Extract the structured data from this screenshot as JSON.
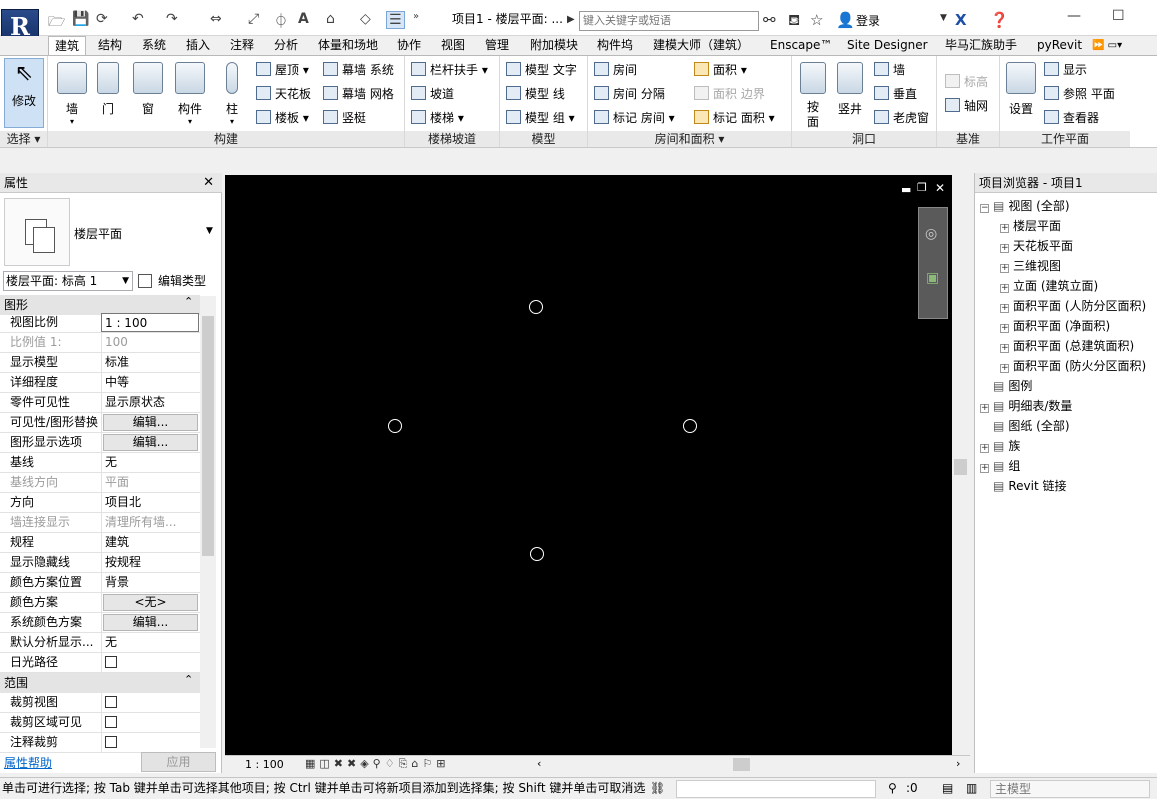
{
  "titlebar": {
    "title": "项目1 - 楼层平面: ...",
    "search_placeholder": "键入关键字或短语",
    "login": "登录"
  },
  "tabs": [
    "建筑",
    "结构",
    "系统",
    "插入",
    "注释",
    "分析",
    "体量和场地",
    "协作",
    "视图",
    "管理",
    "附加模块",
    "构件坞",
    "建模大师（建筑）",
    "Enscape™",
    "Site Designer",
    "毕马汇族助手",
    "pyRevit"
  ],
  "ribbon": {
    "modify": "修改",
    "select": "选择",
    "build": {
      "label": "构建",
      "wall": "墙",
      "door": "门",
      "window": "窗",
      "component": "构件",
      "column": "柱",
      "roof": "屋顶",
      "ceiling": "天花板",
      "floor": "楼板",
      "curtain_system": "幕墙 系统",
      "curtain_grid": "幕墙 网格",
      "mullion": "竖梃"
    },
    "stairs": {
      "label": "楼梯坡道",
      "railing": "栏杆扶手",
      "ramp": "坡道",
      "stair": "楼梯"
    },
    "model": {
      "label": "模型",
      "text": "模型 文字",
      "line": "模型 线",
      "group": "模型 组"
    },
    "room": {
      "label": "房间和面积",
      "room": "房间",
      "separator": "房间 分隔",
      "tag": "标记 房间",
      "area": "面积",
      "area_boundary": "面积 边界",
      "area_tag": "标记 面积"
    },
    "opening": {
      "label": "洞口",
      "by_face": "按面",
      "shaft": "竖井",
      "wall": "墙",
      "vertical": "垂直",
      "dormer": "老虎窗"
    },
    "datum": {
      "label": "基准",
      "level": "标高",
      "grid": "轴网"
    },
    "workplane": {
      "label": "工作平面",
      "set": "设置",
      "show": "显示",
      "ref_plane": "参照 平面",
      "viewer": "查看器"
    }
  },
  "properties": {
    "title": "属性",
    "type_name": "楼层平面",
    "selector": "楼层平面: 标高 1",
    "edit_type": "编辑类型",
    "section_graphics": "图形",
    "section_extents": "范围",
    "rows": [
      {
        "k": "视图比例",
        "v": "1 : 100"
      },
      {
        "k": "比例值 1:",
        "v": "100"
      },
      {
        "k": "显示模型",
        "v": "标准"
      },
      {
        "k": "详细程度",
        "v": "中等"
      },
      {
        "k": "零件可见性",
        "v": "显示原状态"
      },
      {
        "k": "可见性/图形替换",
        "v": "编辑..."
      },
      {
        "k": "图形显示选项",
        "v": "编辑..."
      },
      {
        "k": "基线",
        "v": "无"
      },
      {
        "k": "基线方向",
        "v": "平面"
      },
      {
        "k": "方向",
        "v": "项目北"
      },
      {
        "k": "墙连接显示",
        "v": "清理所有墙..."
      },
      {
        "k": "规程",
        "v": "建筑"
      },
      {
        "k": "显示隐藏线",
        "v": "按规程"
      },
      {
        "k": "颜色方案位置",
        "v": "背景"
      },
      {
        "k": "颜色方案",
        "v": "<无>"
      },
      {
        "k": "系统颜色方案",
        "v": "编辑..."
      },
      {
        "k": "默认分析显示...",
        "v": "无"
      },
      {
        "k": "日光路径",
        "v": ""
      }
    ],
    "extent_rows": [
      {
        "k": "裁剪视图",
        "v": ""
      },
      {
        "k": "裁剪区域可见",
        "v": ""
      },
      {
        "k": "注释裁剪",
        "v": ""
      }
    ],
    "help": "属性帮助",
    "apply": "应用"
  },
  "browser": {
    "title": "项目浏览器 - 项目1",
    "items": [
      {
        "label": "视图 (全部)",
        "level": 0,
        "exp": "⊟"
      },
      {
        "label": "楼层平面",
        "level": 1,
        "exp": "⊞"
      },
      {
        "label": "天花板平面",
        "level": 1,
        "exp": "⊞"
      },
      {
        "label": "三维视图",
        "level": 1,
        "exp": "⊞"
      },
      {
        "label": "立面 (建筑立面)",
        "level": 1,
        "exp": "⊞"
      },
      {
        "label": "面积平面 (人防分区面积)",
        "level": 1,
        "exp": "⊞"
      },
      {
        "label": "面积平面 (净面积)",
        "level": 1,
        "exp": "⊞"
      },
      {
        "label": "面积平面 (总建筑面积)",
        "level": 1,
        "exp": "⊞"
      },
      {
        "label": "面积平面 (防火分区面积)",
        "level": 1,
        "exp": "⊞"
      },
      {
        "label": "图例",
        "level": 0,
        "exp": ""
      },
      {
        "label": "明细表/数量",
        "level": 0,
        "exp": "⊞"
      },
      {
        "label": "图纸 (全部)",
        "level": 0,
        "exp": ""
      },
      {
        "label": "族",
        "level": 0,
        "exp": "⊞"
      },
      {
        "label": "组",
        "level": 0,
        "exp": "⊞"
      },
      {
        "label": "Revit 链接",
        "level": 0,
        "exp": ""
      }
    ]
  },
  "viewbar": {
    "scale": "1 : 100"
  },
  "status": {
    "message": "单击可进行选择; 按 Tab 键并单击可选择其他项目; 按 Ctrl 键并单击可将新项目添加到选择集; 按 Shift 键并单击可取消选",
    "filter": ":0",
    "model": "主模型"
  }
}
